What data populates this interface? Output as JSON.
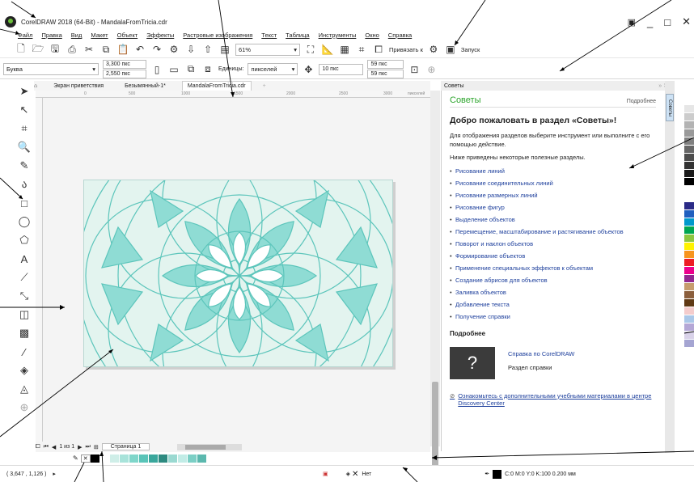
{
  "window": {
    "title": "CorelDRAW 2018 (64-Bit) - MandalaFromTricia.cdr",
    "controls": [
      "_",
      "□",
      "✕"
    ]
  },
  "menu": [
    "Файл",
    "Правка",
    "Вид",
    "Макет",
    "Объект",
    "Эффекты",
    "Растровые изображения",
    "Текст",
    "Таблица",
    "Инструменты",
    "Окно",
    "Справка"
  ],
  "standard_toolbar": {
    "zoom": "61%",
    "snap_label": "Привязать к",
    "launch_label": "Запуск"
  },
  "property_bar": {
    "preset": "Буква",
    "width": "3,300 пкс",
    "height": "2,550 пкс",
    "units_label": "Единицы:",
    "units_value": "пикселей",
    "nudge": "10 пкс",
    "dup_x": "59 пкс",
    "dup_y": "59 пкс"
  },
  "tabs": [
    "Экран приветствия",
    "Безымянный-1*",
    "MandalaFromTricia.cdr"
  ],
  "ruler": {
    "ticks": [
      "0",
      "500",
      "1000",
      "1500",
      "2000",
      "2500",
      "3000"
    ],
    "unit": "пикселей"
  },
  "page_nav": {
    "page_count": "1 из 1",
    "page_tab": "Страница 1"
  },
  "status": {
    "coords": "( 3,647 , 1,126 )",
    "fill": "Нет",
    "outline": "C:0 M:0 Y:0 K:100  0.200 мм"
  },
  "docker": {
    "head": "Советы",
    "title": "Советы",
    "more": "Подробнее",
    "welcome": "Добро пожаловать в раздел «Советы»!",
    "intro": "Для отображения разделов выберите инструмент или выполните с его помощью действие.",
    "list_intro": "Ниже приведены некоторые полезные разделы.",
    "topics": [
      "Рисование линий",
      "Рисование соединительных линий",
      "Рисование размерных линий",
      "Рисование фигур",
      "Выделение объектов",
      "Перемещение, масштабирование и растягивание объектов",
      "Поворот и наклон объектов",
      "Формирование объектов",
      "Применение специальных эффектов к объектам",
      "Создание абрисов для объектов",
      "Заливка объектов",
      "Добавление текста",
      "Получение справки"
    ],
    "more_heading": "Подробнее",
    "help_link": "Справка по CorelDRAW",
    "help_section": "Раздел справки",
    "discovery": "Ознакомьтесь с дополнительными учебными материалами в центре Discovery Center",
    "side_tab": "Советы"
  },
  "palette_colors": [
    "#ffffff",
    "#e6e6e6",
    "#cccccc",
    "#b3b3b3",
    "#999999",
    "#808080",
    "#666666",
    "#4d4d4d",
    "#333333",
    "#1a1a1a",
    "#000000",
    "#ffffff",
    "#ffffff",
    "#2a2a86",
    "#1f5fbf",
    "#0099cc",
    "#00a651",
    "#8dc63f",
    "#fff200",
    "#f7941d",
    "#ed1c24",
    "#ec008c",
    "#92278f",
    "#c69c6d",
    "#8b5e3c",
    "#603913",
    "#f4cccc",
    "#aac7e8",
    "#b4a7d6",
    "#d9d2e9",
    "#a5a5d2"
  ],
  "doc_palette": [
    "#000000",
    "#ffffff",
    "#cfeee8",
    "#a8e3da",
    "#7fd6ca",
    "#59c4b8",
    "#3aa79c",
    "#2d8a80",
    "#9ad9d1",
    "#c1ece6",
    "#7bcfc5",
    "#5bb8ae"
  ],
  "colors": {
    "accent_green": "#2ca52c",
    "link_blue": "#1d3f9c",
    "mandala_bg": "#e3f4ef",
    "mandala_fill": "#8fdcd4",
    "mandala_line": "#5cc5bb"
  }
}
